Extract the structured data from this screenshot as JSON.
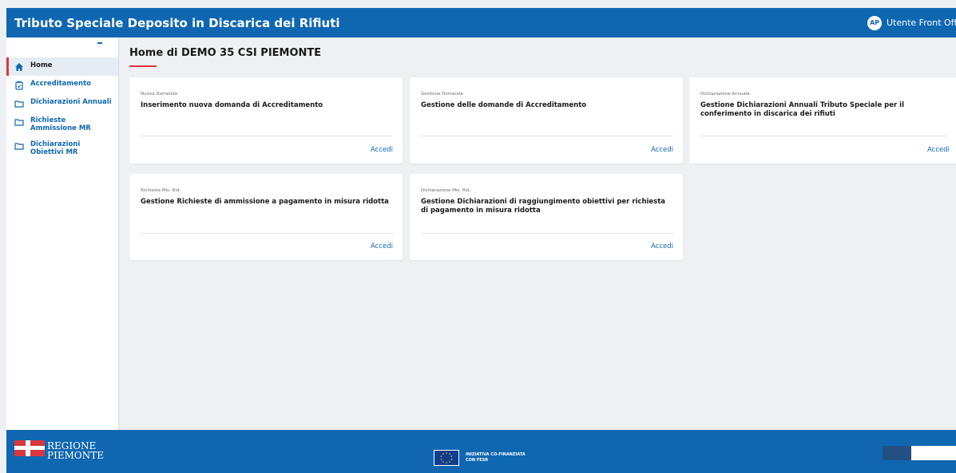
{
  "header": {
    "title": "Tributo Speciale Deposito in Discarica dei Rifiuti",
    "avatar_initials": "AP",
    "user_name": "Utente Front Office"
  },
  "sidebar": {
    "items": [
      {
        "label": "Home",
        "icon": "home-icon",
        "active": true
      },
      {
        "label": "Accreditamento",
        "icon": "clipboard-icon"
      },
      {
        "label": "Dichiarazioni Annuali",
        "icon": "folder-icon"
      },
      {
        "label": "Richieste Ammissione MR",
        "icon": "folder-icon"
      },
      {
        "label": "Dichiarazioni Obiettivi MR",
        "icon": "folder-icon"
      }
    ]
  },
  "main": {
    "title": "Home di DEMO 35 CSI PIEMONTE",
    "cards": [
      {
        "kicker": "Nuova Domanda",
        "title": "Inserimento nuova domanda di Accreditamento",
        "link": "Accedi"
      },
      {
        "kicker": "Gestione Domande",
        "title": "Gestione delle domande di Accreditamento",
        "link": "Accedi"
      },
      {
        "kicker": "Dichiarazione Annuale",
        "title": "Gestione Dichiarazioni Annuali Tributo Speciale per il conferimento in discarica dei rifiuti",
        "link": "Accedi"
      },
      {
        "kicker": "Richiesta Mis. Rid.",
        "title": "Gestione Richieste di ammissione a pagamento in misura ridotta",
        "link": "Accedi"
      },
      {
        "kicker": "Dichiarazione Mis. Rid.",
        "title": "Gestione Dichiarazioni di raggiungimento obiettivi per richiesta di pagamento in misura ridotta",
        "link": "Accedi"
      }
    ]
  },
  "footer": {
    "region_line1": "REGIONE",
    "region_line2": "PIEMONTE",
    "eu_line1": "INIZIATIVA CO-FINANZIATA",
    "eu_line2": "CON FESR"
  },
  "colors": {
    "primary": "#0f67b1",
    "accent": "#d9363e",
    "background": "#eef0f3"
  }
}
